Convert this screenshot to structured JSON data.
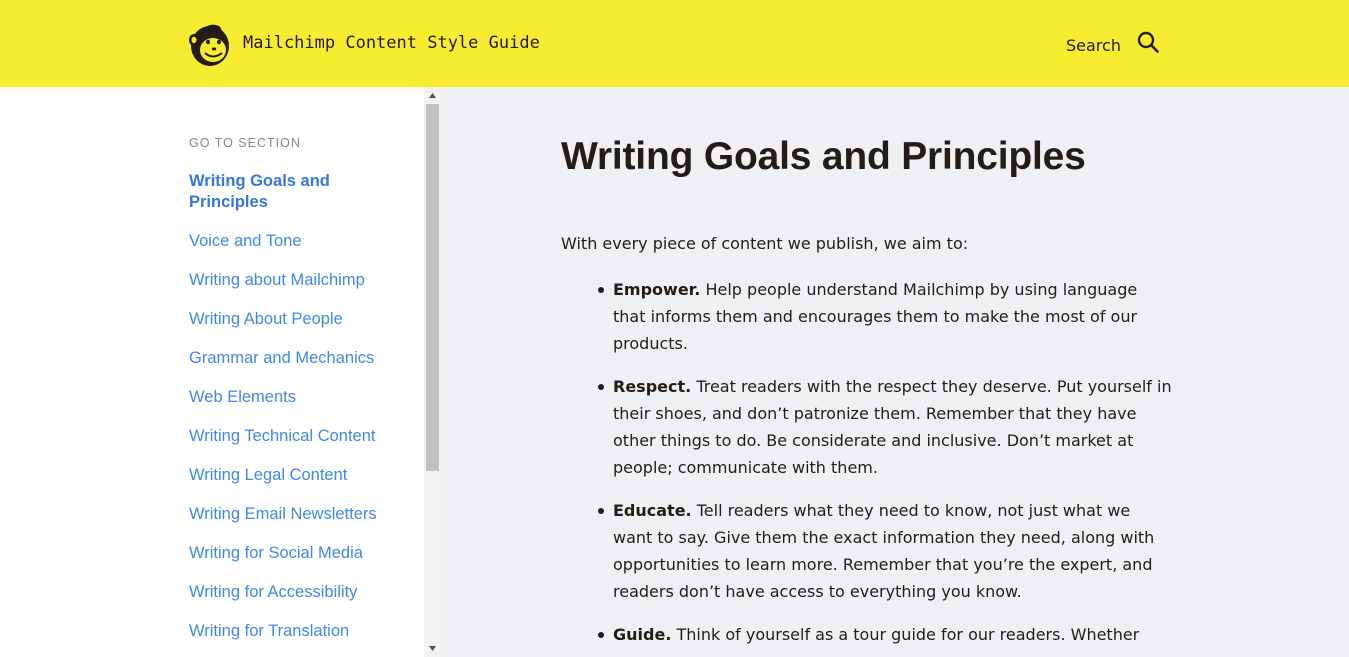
{
  "header": {
    "site_title": "Mailchimp Content Style Guide",
    "search_label": "Search",
    "logo_icon": "freddie-monkey-logo",
    "search_icon": "magnifier-icon",
    "background_color": "#f8ec30"
  },
  "sidebar": {
    "section_label": "GO TO SECTION",
    "items": [
      {
        "label": "Writing Goals and Principles",
        "active": true
      },
      {
        "label": "Voice and Tone",
        "active": false
      },
      {
        "label": "Writing about Mailchimp",
        "active": false
      },
      {
        "label": "Writing About People",
        "active": false
      },
      {
        "label": "Grammar and Mechanics",
        "active": false
      },
      {
        "label": "Web Elements",
        "active": false
      },
      {
        "label": "Writing Technical Content",
        "active": false
      },
      {
        "label": "Writing Legal Content",
        "active": false
      },
      {
        "label": "Writing Email Newsletters",
        "active": false
      },
      {
        "label": "Writing for Social Media",
        "active": false
      },
      {
        "label": "Writing for Accessibility",
        "active": false
      },
      {
        "label": "Writing for Translation",
        "active": false
      }
    ],
    "link_color": "#3f88ec"
  },
  "main": {
    "title": "Writing Goals and Principles",
    "intro": "With every piece of content we publish, we aim to:",
    "principles": [
      {
        "term": "Empower.",
        "text": "Help people understand Mailchimp by using language that informs them and encourages them to make the most of our products."
      },
      {
        "term": "Respect.",
        "text": "Treat readers with the respect they deserve. Put yourself in their shoes, and don’t patronize them. Remember that they have other things to do. Be considerate and inclusive. Don’t market at people; communicate with them."
      },
      {
        "term": "Educate.",
        "text": "Tell readers what they need to know, not just what we want to say. Give them the exact information they need, along with opportunities to learn more. Remember that you’re the expert, and readers don’t have access to everything you know."
      },
      {
        "term": "Guide.",
        "text": "Think of yourself as a tour guide for our readers. Whether"
      }
    ]
  }
}
